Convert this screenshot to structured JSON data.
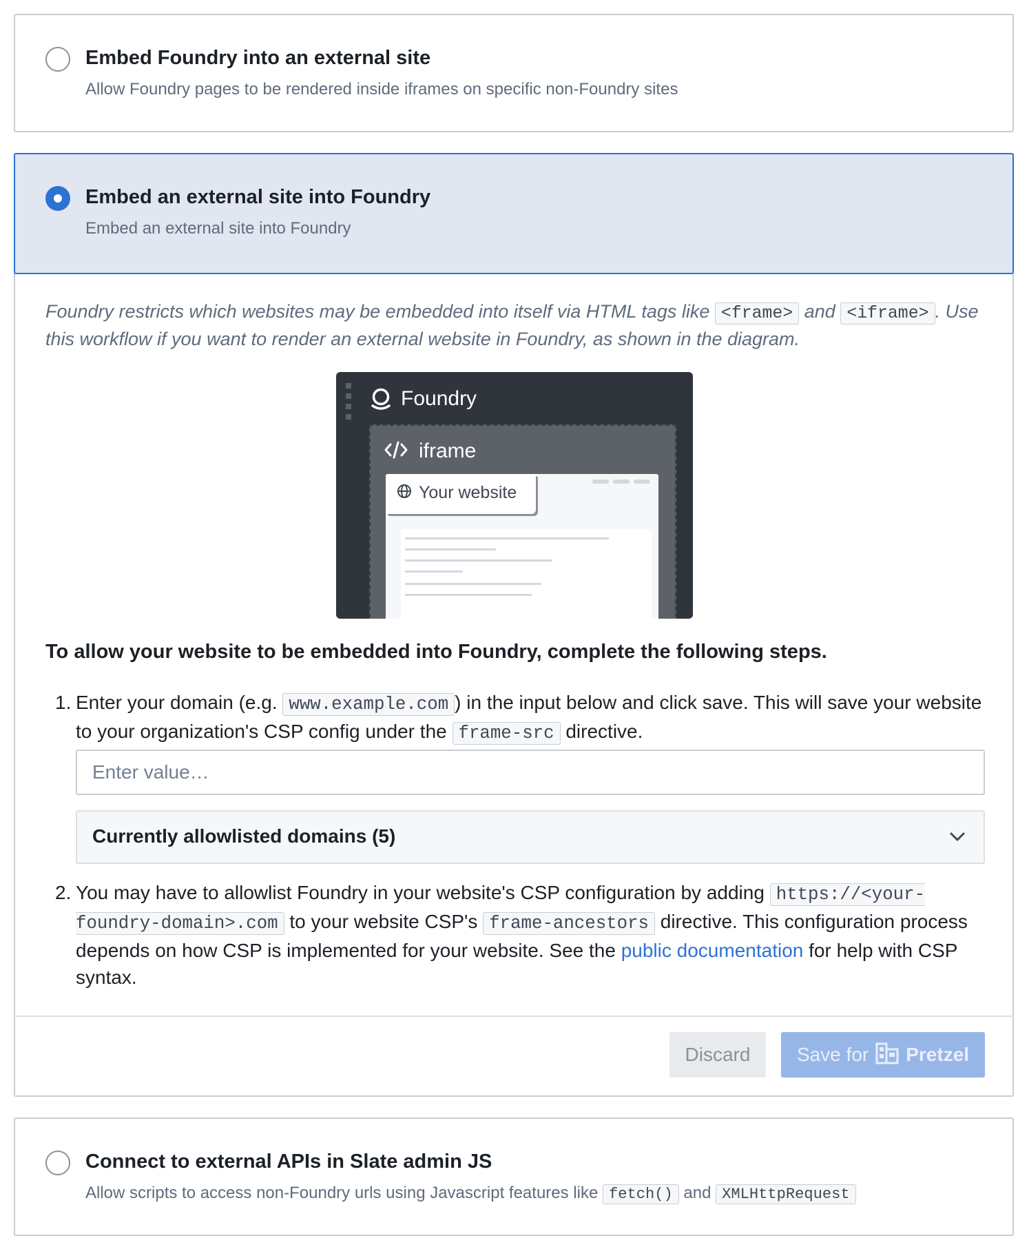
{
  "options": [
    {
      "title": "Embed Foundry into an external site",
      "description": "Allow Foundry pages to be rendered inside iframes on specific non-Foundry sites",
      "selected": false
    },
    {
      "title": "Embed an external site into Foundry",
      "description": "Embed an external site into Foundry",
      "selected": true
    },
    {
      "title": "Connect to external APIs in Slate admin JS",
      "description_prefix": "Allow scripts to access non-Foundry urls using Javascript features like",
      "code1": "fetch()",
      "and": "and",
      "code2": "XMLHttpRequest",
      "selected": false
    }
  ],
  "intro": {
    "part1": "Foundry restricts which websites may be embedded into itself via HTML tags like",
    "code1": "<frame>",
    "and": "and",
    "code2": "<iframe>",
    "part2": ". Use this workflow if you want to render an external website in Foundry, as shown in the diagram."
  },
  "diagram": {
    "app_label": "Foundry",
    "iframe_label": "iframe",
    "website_label": "Your website",
    "icons": [
      "foundry-logo-icon",
      "code-icon",
      "globe-icon"
    ]
  },
  "steps_heading": "To allow your website to be embedded into Foundry, complete the following steps.",
  "step1": {
    "num": "1.",
    "part1": "Enter your domain (e.g.",
    "code1": "www.example.com",
    "part2": ") in the input below and click save. This will save your website to your organization's CSP config under the",
    "code2": "frame-src",
    "part3": "directive."
  },
  "domain_input": {
    "placeholder": "Enter value…",
    "value": ""
  },
  "allowlisted": {
    "label": "Currently allowlisted domains (5)",
    "icon": "chevron-down-icon"
  },
  "step2": {
    "num": "2.",
    "part1": "You may have to allowlist Foundry in your website's CSP configuration by adding",
    "code1": "https://<your-foundry-domain>.com",
    "part2": "to your website CSP's",
    "code2": "frame-ancestors",
    "part3": "directive. This configuration process depends on how CSP is implemented for your website. See the",
    "link": "public documentation",
    "part4": "for help with CSP syntax."
  },
  "buttons": {
    "discard": "Discard",
    "save_prefix": "Save for",
    "org_name": "Pretzel",
    "org_icon": "building-icon"
  },
  "colors": {
    "accent": "#2d72d2",
    "selected_bg": "#e1e6f1",
    "muted_text": "#5f6b7c"
  }
}
